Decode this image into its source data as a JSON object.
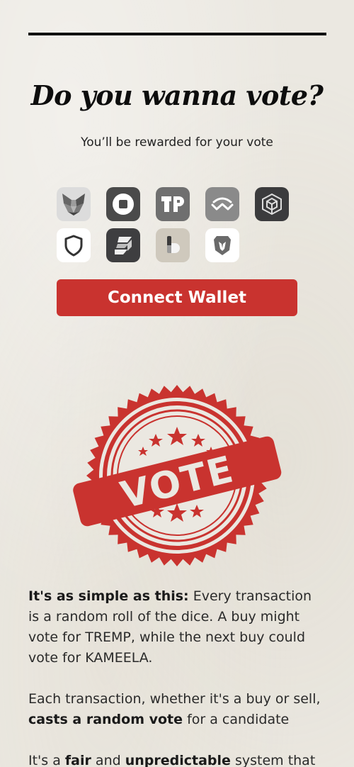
{
  "header": {
    "title": "Do you wanna vote?",
    "subtitle": "You’ll be rewarded for your vote"
  },
  "wallets": [
    {
      "name": "metamask-icon",
      "bg": "#dcdcdc"
    },
    {
      "name": "coinbase-icon",
      "bg": "#4a4a4a"
    },
    {
      "name": "tokenpocket-icon",
      "bg": "#6f6f6f"
    },
    {
      "name": "walletconnect-icon",
      "bg": "#8a8a8a"
    },
    {
      "name": "binance-wallet-icon",
      "bg": "#3b3b3d"
    },
    {
      "name": "trust-wallet-icon",
      "bg": "#ffffff"
    },
    {
      "name": "safepal-icon",
      "bg": "#3e3e40"
    },
    {
      "name": "bitget-wallet-icon",
      "bg": "#cfc9bd"
    },
    {
      "name": "brave-wallet-icon",
      "bg": "#ffffff"
    }
  ],
  "connect_button": {
    "label": "Connect Wallet",
    "color": "#c9332f"
  },
  "stamp": {
    "text": "VOTE",
    "color": "#c9332f"
  },
  "content": {
    "p1_bold": "It's as simple as this:",
    "p1_rest": " Every transaction is a random roll of the dice. A buy might vote for TREMP, while the next buy could vote for KAMEELA.",
    "p2_start": "Each transaction, whether it's a buy or sell, ",
    "p2_bold": "casts a random vote",
    "p2_end": " for a candidate",
    "p3_start": "It's a ",
    "p3_bold1": "fair",
    "p3_mid": " and ",
    "p3_bold2": "unpredictable",
    "p3_end": " system that"
  }
}
